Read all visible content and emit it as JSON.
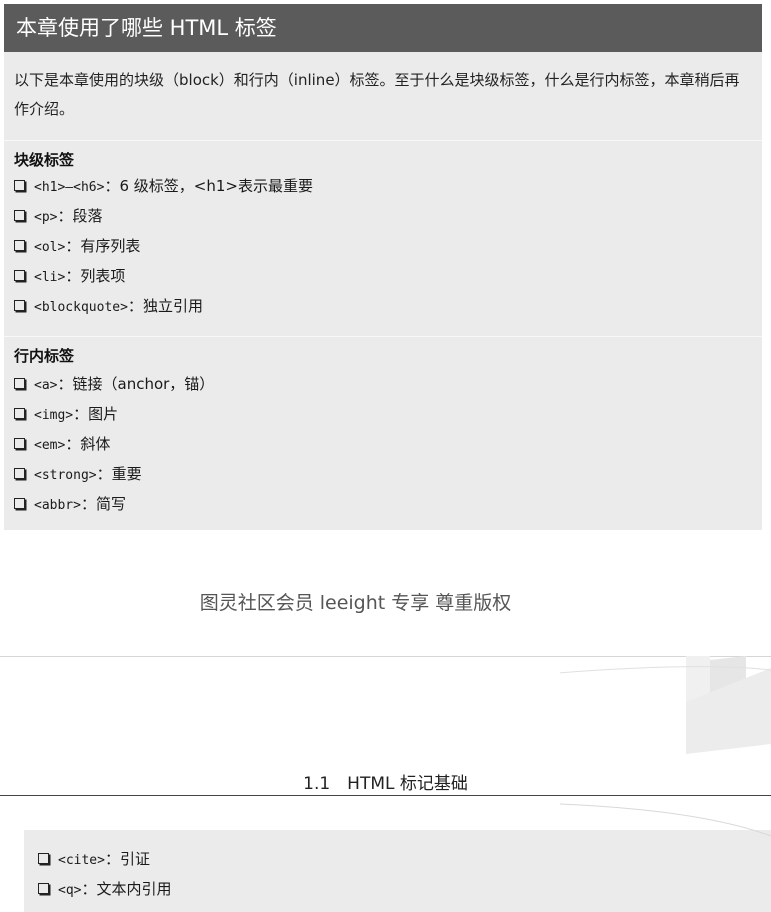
{
  "box": {
    "title": "本章使用了哪些 HTML 标签",
    "intro": "以下是本章使用的块级（block）和行内（inline）标签。至于什么是块级标签，什么是行内标签，本章稍后再作介绍。",
    "block_heading": "块级标签",
    "block_items": [
      {
        "code": "<h1>–<h6>",
        "sep": "：",
        "desc": "6 级标签，<h1>表示最重要"
      },
      {
        "code": "<p>",
        "sep": "：",
        "desc": "段落"
      },
      {
        "code": "<ol>",
        "sep": "：",
        "desc": "有序列表"
      },
      {
        "code": "<li>",
        "sep": "：",
        "desc": "列表项"
      },
      {
        "code": "<blockquote>",
        "sep": "：",
        "desc": "独立引用"
      }
    ],
    "inline_heading": "行内标签",
    "inline_items": [
      {
        "code": "<a>",
        "sep": "：",
        "desc": "链接（anchor，锚）"
      },
      {
        "code": "<img>",
        "sep": "：",
        "desc": "图片"
      },
      {
        "code": "<em>",
        "sep": "：",
        "desc": "斜体"
      },
      {
        "code": "<strong>",
        "sep": "：",
        "desc": "重要"
      },
      {
        "code": "<abbr>",
        "sep": "：",
        "desc": "简写"
      }
    ]
  },
  "watermark": "图灵社区会员 leeight 专享 尊重版权",
  "chapter_heading": "1.1　HTML 标记基础",
  "bottom_items": [
    {
      "code": "<cite>",
      "sep": "：",
      "desc": "引证"
    },
    {
      "code": "<q>",
      "sep": "：",
      "desc": "文本内引用"
    }
  ],
  "icons": {
    "bullet": "checkbox-square-icon"
  },
  "colors": {
    "title_bar": "#5b5b5b",
    "box_bg": "#ebebeb"
  }
}
